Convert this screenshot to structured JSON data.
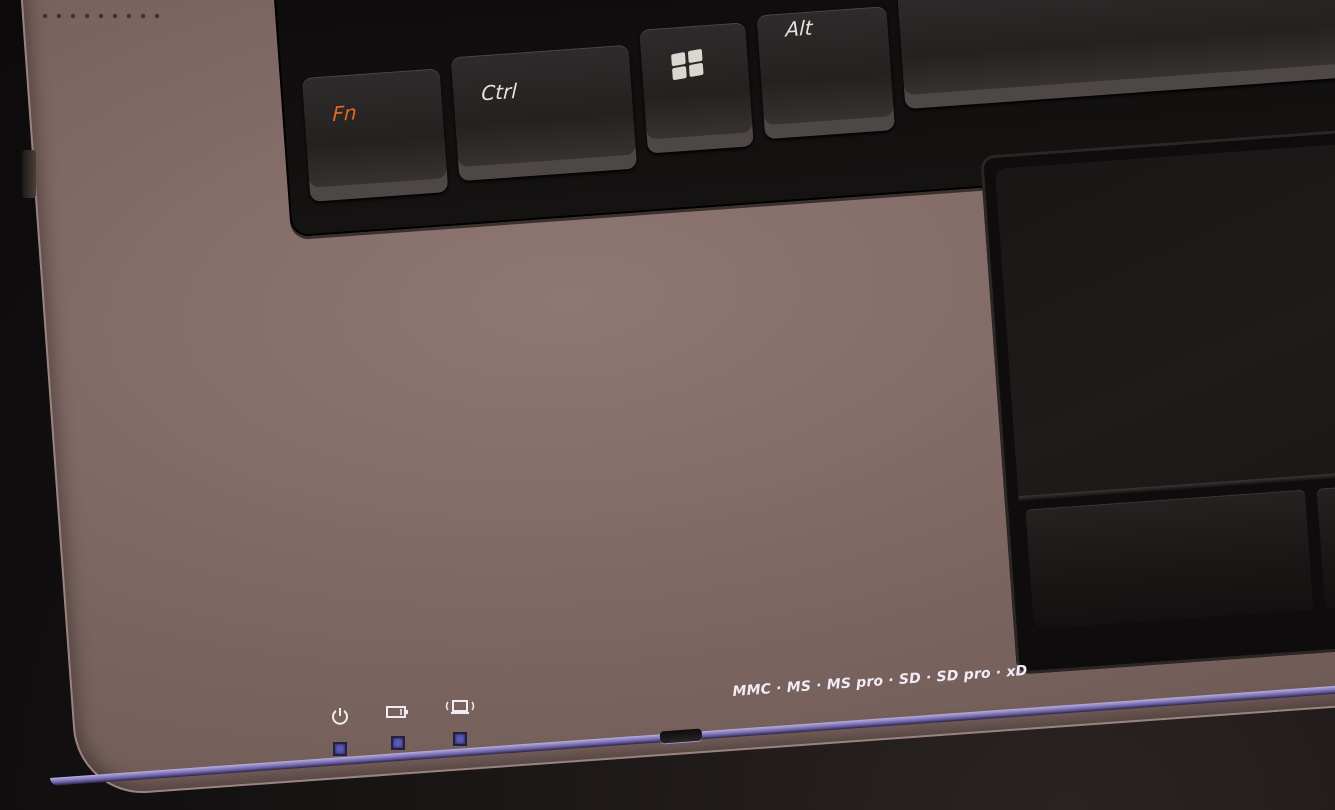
{
  "keyboard": {
    "keys": {
      "fn": "Fn",
      "ctrl": "Ctrl",
      "alt": "Alt"
    },
    "fn_label_color": "#e06a22"
  },
  "indicators": [
    {
      "icon": "power-icon"
    },
    {
      "icon": "battery-icon"
    },
    {
      "icon": "wireless-icon"
    }
  ],
  "card_reader": {
    "label": "MMC · MS · MS pro · SD · SD pro · xD"
  },
  "colors": {
    "palmrest": "#836b67",
    "edge_accent": "#8c84cc",
    "led": "#5b5bb8"
  }
}
